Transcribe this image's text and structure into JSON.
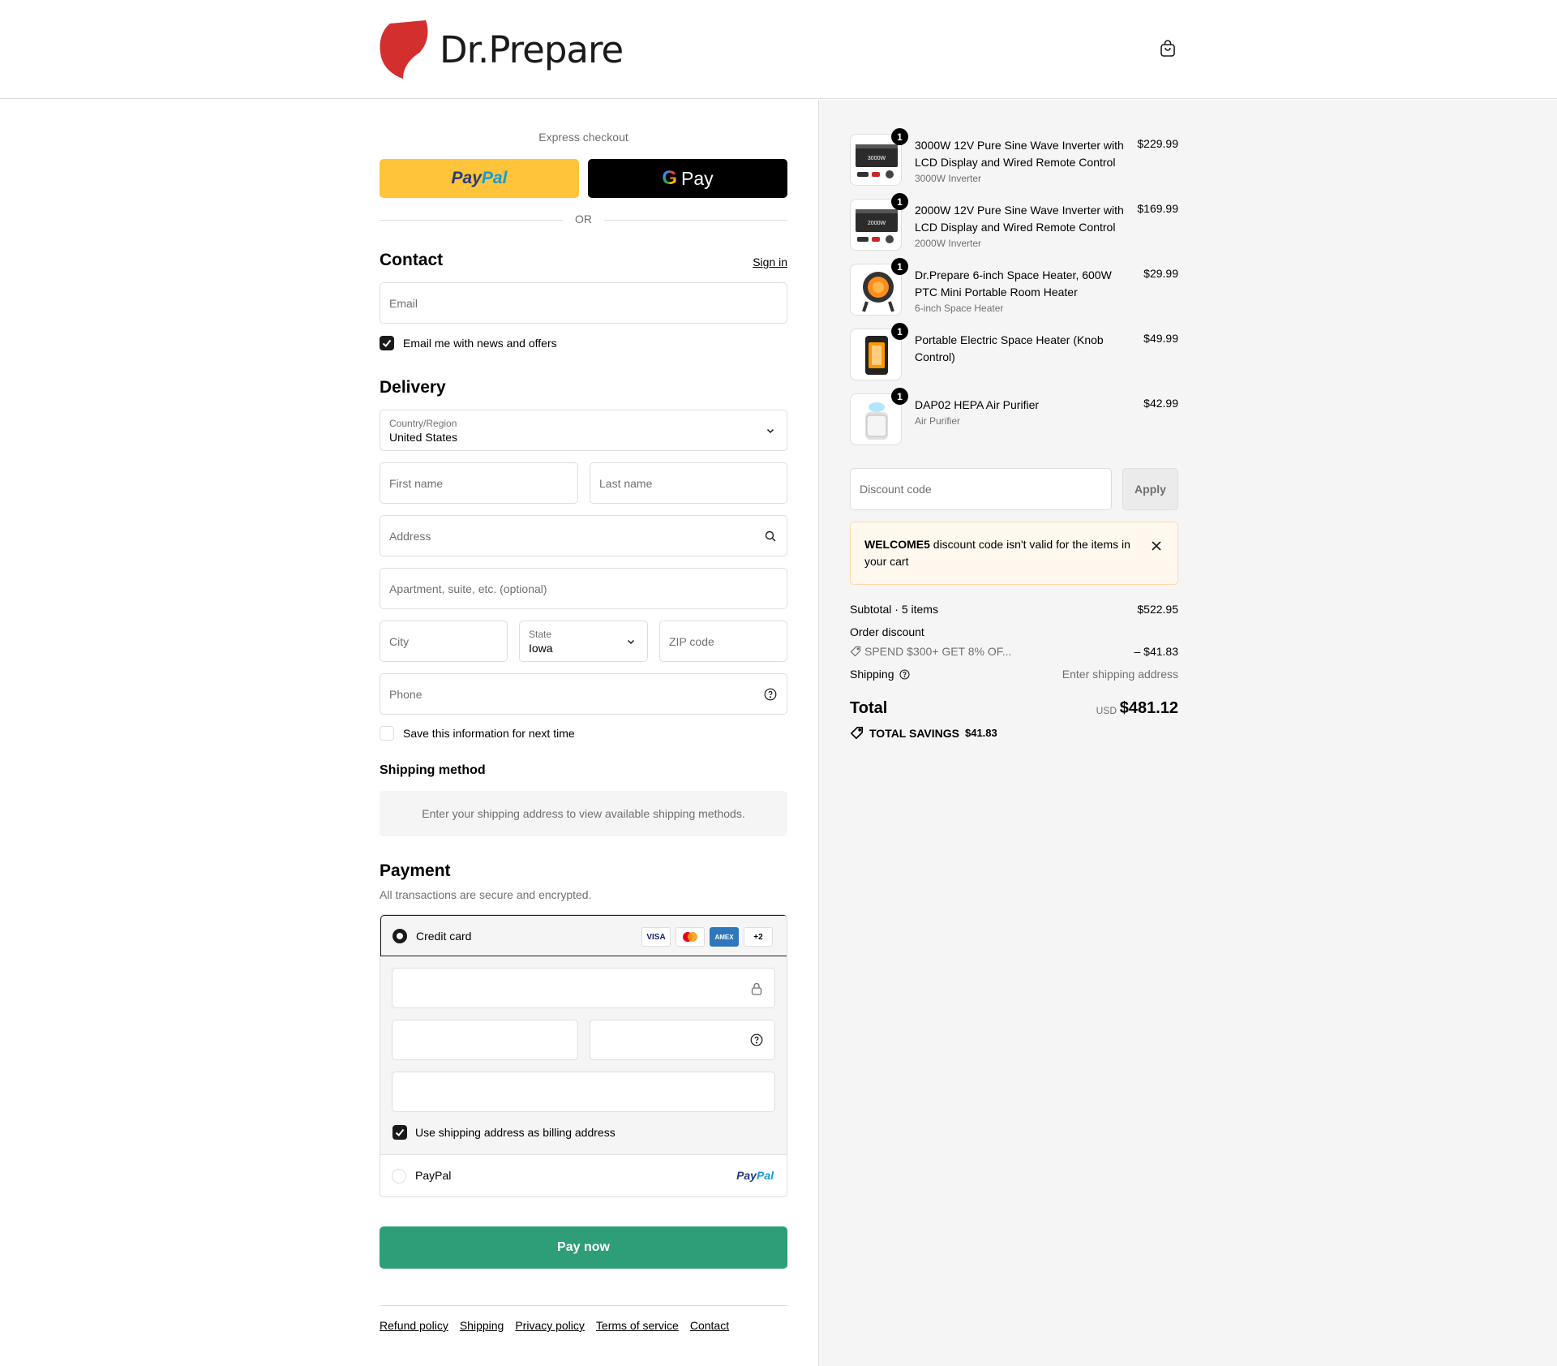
{
  "brand": {
    "name": "Dr.Prepare",
    "accent": "#d32f2f"
  },
  "header": {
    "cart_icon": "shopping-bag-icon"
  },
  "express": {
    "label": "Express checkout",
    "paypal_a": "Pay",
    "paypal_b": "Pal",
    "gpay_g": "G",
    "gpay_label": "Pay",
    "or": "OR"
  },
  "contact": {
    "title": "Contact",
    "signin": "Sign in",
    "email_placeholder": "Email",
    "newsletter_label": "Email me with news and offers",
    "newsletter_checked": true
  },
  "delivery": {
    "title": "Delivery",
    "country_label": "Country/Region",
    "country_value": "United States",
    "first_name": "First name",
    "last_name": "Last name",
    "address": "Address",
    "apartment": "Apartment, suite, etc. (optional)",
    "city": "City",
    "state_label": "State",
    "state_value": "Iowa",
    "zip": "ZIP code",
    "phone": "Phone",
    "save_label": "Save this information for next time",
    "save_checked": false
  },
  "shipping_method": {
    "title": "Shipping method",
    "message": "Enter your shipping address to view available shipping methods."
  },
  "payment": {
    "title": "Payment",
    "subtitle": "All transactions are secure and encrypted.",
    "credit_card": "Credit card",
    "cards": [
      "VISA",
      "MC",
      "AMEX",
      "+2"
    ],
    "billing_label": "Use shipping address as billing address",
    "billing_checked": true,
    "paypal": "PayPal",
    "paypal_logo_a": "Pay",
    "paypal_logo_b": "Pal",
    "pay_now": "Pay now",
    "button_color": "#2e9e78"
  },
  "footer": {
    "links": [
      "Refund policy",
      "Shipping",
      "Privacy policy",
      "Terms of service",
      "Contact"
    ]
  },
  "order": {
    "items": [
      {
        "name": "3000W 12V Pure Sine Wave Inverter with LCD Display and Wired Remote Control",
        "variant": "3000W Inverter",
        "price": "$229.99",
        "qty": "1",
        "thumb_label": "3000W"
      },
      {
        "name": "2000W 12V Pure Sine Wave Inverter with LCD Display and Wired Remote Control",
        "variant": "2000W Inverter",
        "price": "$169.99",
        "qty": "1",
        "thumb_label": "2000W"
      },
      {
        "name": "Dr.Prepare 6-inch Space Heater, 600W PTC Mini Portable Room Heater",
        "variant": "6-inch Space Heater",
        "price": "$29.99",
        "qty": "1"
      },
      {
        "name": "Portable Electric Space Heater (Knob Control)",
        "variant": "",
        "price": "$49.99",
        "qty": "1"
      },
      {
        "name": "DAP02 HEPA Air Purifier",
        "variant": "Air Purifier",
        "price": "$42.99",
        "qty": "1"
      }
    ],
    "discount_placeholder": "Discount code",
    "apply": "Apply",
    "notice_code": "WELCOME5",
    "notice_text": " discount code isn't valid for the items in your cart",
    "subtotal_label": "Subtotal · 5 items",
    "subtotal_value": "$522.95",
    "order_discount_label": "Order discount",
    "discount_name": "SPEND $300+ GET 8% OF...",
    "discount_value": "– $41.83",
    "shipping_label": "Shipping",
    "shipping_value": "Enter shipping address",
    "total_label": "Total",
    "currency": "USD",
    "total_value": "$481.12",
    "savings_label": "TOTAL SAVINGS",
    "savings_value": "$41.83"
  }
}
